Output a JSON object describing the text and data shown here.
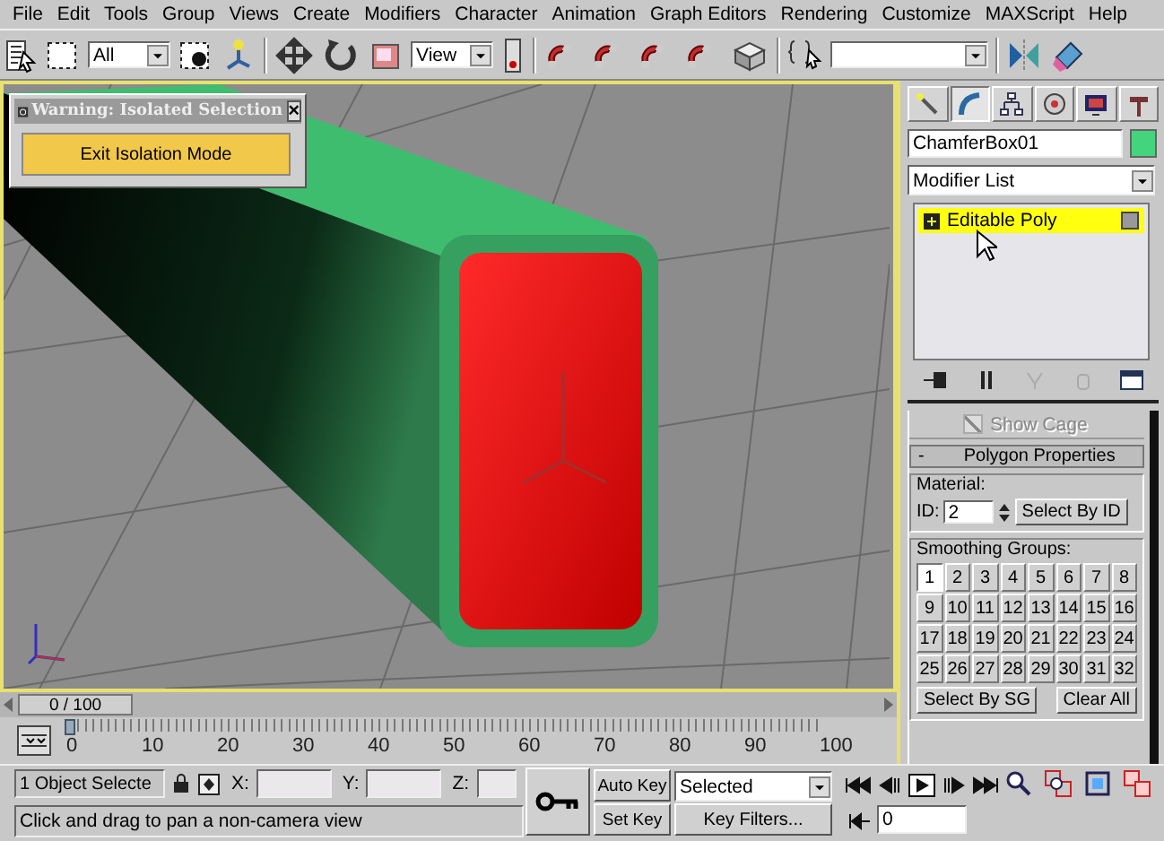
{
  "menu": [
    "File",
    "Edit",
    "Tools",
    "Group",
    "Views",
    "Create",
    "Modifiers",
    "Character",
    "Animation",
    "Graph Editors",
    "Rendering",
    "Customize",
    "MAXScript",
    "Help"
  ],
  "toolbar": {
    "selection_filter": "All",
    "reference_coordinate": "View"
  },
  "isolation_dialog": {
    "title": "Warning: Isolated Selection",
    "close": "×",
    "button": "Exit Isolation Mode"
  },
  "time_slider": {
    "label": "0 / 100",
    "level": 0
  },
  "trackbar": {
    "ticks": [
      "0",
      "10",
      "20",
      "30",
      "40",
      "50",
      "60",
      "70",
      "80",
      "90",
      "100"
    ]
  },
  "command_panel": {
    "tabs": [
      {
        "selected": false
      },
      {
        "selected": true
      },
      {
        "selected": false
      },
      {
        "selected": false
      },
      {
        "selected": false
      },
      {
        "selected": false
      }
    ],
    "object_name": "ChamferBox01",
    "modifier_list": "Modifier List",
    "stack": [
      {
        "label": "Editable Poly",
        "selected": true
      }
    ],
    "show_cage": {
      "label": "Show Cage",
      "checked": true,
      "disabled": true
    },
    "rollout": {
      "sign": "-",
      "title": "Polygon Properties"
    },
    "material": {
      "group": "Material:",
      "id_label": "ID:",
      "id_value": "2",
      "button": "Select By ID"
    },
    "smoothing": {
      "group": "Smoothing Groups:",
      "buttons": [
        {
          "label": "1",
          "selected": true
        },
        {
          "label": "2",
          "selected": false
        },
        {
          "label": "3",
          "selected": false
        },
        {
          "label": "4",
          "selected": false
        },
        {
          "label": "5",
          "selected": false
        },
        {
          "label": "6",
          "selected": false
        },
        {
          "label": "7",
          "selected": false
        },
        {
          "label": "8",
          "selected": false
        },
        {
          "label": "9",
          "selected": false
        },
        {
          "label": "10",
          "selected": false
        },
        {
          "label": "11",
          "selected": false
        },
        {
          "label": "12",
          "selected": false
        },
        {
          "label": "13",
          "selected": false
        },
        {
          "label": "14",
          "selected": false
        },
        {
          "label": "15",
          "selected": false
        },
        {
          "label": "16",
          "selected": false
        },
        {
          "label": "17",
          "selected": false
        },
        {
          "label": "18",
          "selected": false
        },
        {
          "label": "19",
          "selected": false
        },
        {
          "label": "20",
          "selected": false
        },
        {
          "label": "21",
          "selected": false
        },
        {
          "label": "22",
          "selected": false
        },
        {
          "label": "23",
          "selected": false
        },
        {
          "label": "24",
          "selected": false
        },
        {
          "label": "25",
          "selected": false
        },
        {
          "label": "26",
          "selected": false
        },
        {
          "label": "27",
          "selected": false
        },
        {
          "label": "28",
          "selected": false
        },
        {
          "label": "29",
          "selected": false
        },
        {
          "label": "30",
          "selected": false
        },
        {
          "label": "31",
          "selected": false
        },
        {
          "label": "32",
          "selected": false
        }
      ],
      "select_button": "Select By SG",
      "clear_button": "Clear All"
    }
  },
  "status": {
    "selection": "1 Object Selecte",
    "x_label": "X:",
    "y_label": "Y:",
    "z_label": "Z:",
    "auto_key": "Auto Key",
    "key_mode": "Selected",
    "prompt": "Click and drag to pan a non-camera view",
    "set_key": "Set Key",
    "key_filters": "Key Filters...",
    "frame": "0"
  }
}
